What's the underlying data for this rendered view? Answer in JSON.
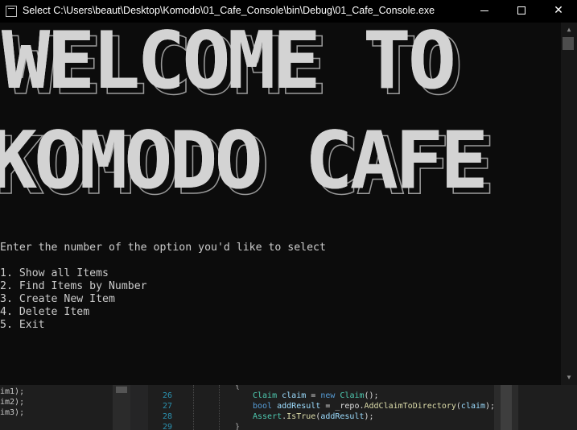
{
  "window": {
    "title": "Select C:\\Users\\beaut\\Desktop\\Komodo\\01_Cafe_Console\\bin\\Debug\\01_Cafe_Console.exe",
    "icon": "console-app-icon",
    "controls": {
      "minimize": "minimize-icon",
      "maximize": "maximize-icon",
      "close_glyph": "✕"
    }
  },
  "console": {
    "banner_line_1": "WELCOME TO",
    "banner_line_2": "KOMODO CAFE",
    "prompt": "Enter the number of the option you'd like to select",
    "menu": [
      "1. Show all Items",
      "2. Find Items by Number",
      "3. Create New Item",
      "4. Delete Item",
      "5. Exit"
    ],
    "background": "#0c0c0c",
    "text_color": "#cccccc"
  },
  "scrollbar": {
    "up_glyph": "▲",
    "down_glyph": "▼"
  },
  "editor_background": {
    "left_lines": [
      "im1);",
      "im2);",
      "im3);"
    ],
    "line_numbers": [
      "26",
      "27",
      "28",
      "29"
    ],
    "brace_top": "{",
    "brace_bottom": "}",
    "code": {
      "l26": {
        "type": "Claim",
        "var": "claim",
        "eq": " = ",
        "kw": "new",
        "sp": " ",
        "ctor": "Claim",
        "end": "();"
      },
      "l27": {
        "kw": "bool",
        "sp": " ",
        "var": "addResult",
        "mid": " = _repo.",
        "fn": "AddClaimToDirectory",
        "open": "(",
        "arg": "claim",
        "end": ");"
      },
      "l28": {
        "type": "Assert",
        "dot": ".",
        "fn": "IsTrue",
        "open": "(",
        "arg": "addResult",
        "end": ");"
      }
    }
  }
}
